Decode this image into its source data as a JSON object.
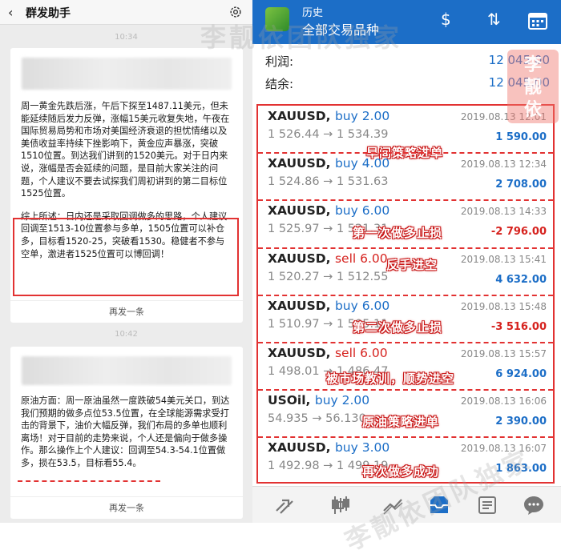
{
  "left": {
    "title": "群发助手",
    "time1": "10:34",
    "time2": "10:42",
    "card1": {
      "para1": "周一黄金先跌后涨，午后下探至1487.11美元，但未能延续随后发力反弹，涨幅15美元收复失地，午夜在国际贸易局势和市场对美国经济衰退的担忧情绪以及美债收益率持续下挫影响下，黄金应声暴涨，突破1510位置。到达我们讲到的1520美元。对于日内来说，涨幅是否会延续的问题，是目前大家关注的问题，个人建议不要去试探我们周初讲到的第二目标位1525位置。",
      "para2": "综上所述：日内还是采取回调做多的思路，个人建议回调至1513-10位置参与多单，1505位置可以补仓多，目标看1520-25，突破看1530。稳健者不参与空单，激进者1525位置可以博回调！",
      "resend": "再发一条"
    },
    "card2": {
      "para1": "原油方面：周一原油虽然一度跌破54美元关口，到达我们预期的做多点位53.5位置，在全球能源需求受打击的背景下，油价大幅反弹，我们布局的多单也顺利离场！对于目前的走势来说，个人还是偏向于做多操作。那么操作上个人建议：回调至54.3-54.1位置做多，损在53.5，目标看55.4。",
      "resend": "再发一条"
    }
  },
  "right": {
    "header_small": "历史",
    "header_title": "全部交易品种",
    "profit_label": "利润:",
    "profit_value": "12 045.00",
    "balance_label": "结余:",
    "balance_value": "12 045.00",
    "trades": [
      {
        "symbol": "XAUUSD,",
        "side": "buy 2.00",
        "type": "buy",
        "date": "2019.08.13 12:01",
        "prices": "1 526.44 → 1 534.39",
        "pl": "1 590.00",
        "plType": "pos",
        "note": "早间策略进单"
      },
      {
        "symbol": "XAUUSD,",
        "side": "buy 4.00",
        "type": "buy",
        "date": "2019.08.13 12:34",
        "prices": "1 524.86 → 1 531.63",
        "pl": "2 708.00",
        "plType": "pos",
        "note": ""
      },
      {
        "symbol": "XAUUSD,",
        "side": "buy 6.00",
        "type": "buy",
        "date": "2019.08.13 14:33",
        "prices": "1 525.97 → 1 521.31",
        "pl": "-2 796.00",
        "plType": "neg",
        "note": "第一次做多止损"
      },
      {
        "symbol": "XAUUSD,",
        "side": "sell 6.00",
        "type": "sell",
        "date": "2019.08.13 15:41",
        "prices": "1 520.27 → 1 512.55",
        "pl": "4 632.00",
        "plType": "pos",
        "note": "反手进空"
      },
      {
        "symbol": "XAUUSD,",
        "side": "buy 6.00",
        "type": "buy",
        "date": "2019.08.13 15:48",
        "prices": "1 510.97 → 1 505.11",
        "pl": "-3 516.00",
        "plType": "neg",
        "note": "第二次做多止损"
      },
      {
        "symbol": "XAUUSD,",
        "side": "sell 6.00",
        "type": "sell",
        "date": "2019.08.13 15:57",
        "prices": "1 498.01 → 1 486.47",
        "pl": "6 924.00",
        "plType": "pos",
        "note": "被市场教训，顺势进空"
      },
      {
        "symbol": "USOil,",
        "side": "buy 2.00",
        "type": "buy",
        "date": "2019.08.13 16:06",
        "prices": "54.935 → 56.130",
        "pl": "2 390.00",
        "plType": "pos",
        "note": "原油策略进单"
      },
      {
        "symbol": "XAUUSD,",
        "side": "buy 3.00",
        "type": "buy",
        "date": "2019.08.13 16:07",
        "prices": "1 492.98 → 1 499.19",
        "pl": "1 863.00",
        "plType": "pos",
        "note": "再次做多成功"
      }
    ]
  },
  "watermark": "李靓依团队独家",
  "seal": "李靓依",
  "colors": {
    "accent": "#1c6ec7",
    "annotation": "#e23232",
    "loss": "#d6221e"
  }
}
